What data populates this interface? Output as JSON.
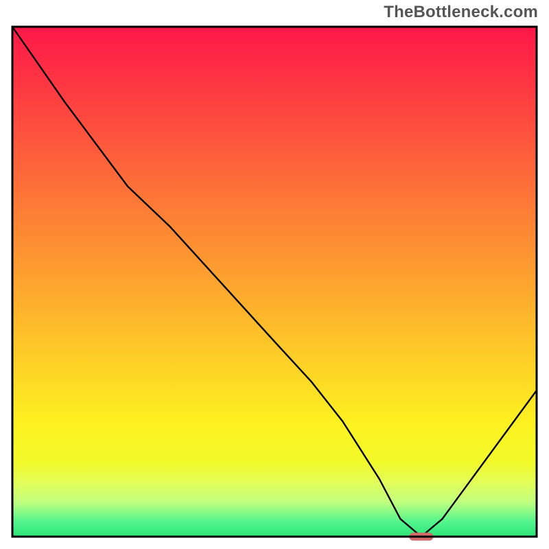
{
  "watermark": "TheBottleneck.com",
  "chart_data": {
    "type": "line",
    "title": "",
    "xlabel": "",
    "ylabel": "",
    "xlim": [
      0,
      100
    ],
    "ylim": [
      0,
      115
    ],
    "series": [
      {
        "name": "bottleneck-curve",
        "x": [
          0,
          10,
          22,
          30,
          40,
          50,
          57,
          63,
          70,
          74,
          78,
          82,
          100
        ],
        "y": [
          115,
          98,
          79,
          70,
          57,
          44,
          35,
          26,
          13,
          4,
          0,
          4,
          33
        ]
      }
    ],
    "marker": {
      "x": 78,
      "y": 0,
      "width_units": 4.6,
      "height_units": 1.8,
      "color": "#d46a6a"
    },
    "frame": {
      "x0": 18,
      "y0": 39,
      "x1": 782,
      "y1": 782,
      "stroke": "#000000",
      "stroke_width": 3
    },
    "gradient_stops": [
      {
        "offset": 0.0,
        "color": "#fd1848"
      },
      {
        "offset": 0.078,
        "color": "#fd2d44"
      },
      {
        "offset": 0.155,
        "color": "#fd4340"
      },
      {
        "offset": 0.233,
        "color": "#fd593c"
      },
      {
        "offset": 0.311,
        "color": "#fd6f38"
      },
      {
        "offset": 0.388,
        "color": "#fd8534"
      },
      {
        "offset": 0.466,
        "color": "#fd9a30"
      },
      {
        "offset": 0.544,
        "color": "#fdb02c"
      },
      {
        "offset": 0.621,
        "color": "#fdc628"
      },
      {
        "offset": 0.699,
        "color": "#fddc24"
      },
      {
        "offset": 0.777,
        "color": "#fdf120"
      },
      {
        "offset": 0.854,
        "color": "#f2fa29"
      },
      {
        "offset": 0.893,
        "color": "#e3fe58"
      },
      {
        "offset": 0.932,
        "color": "#c2ff7f"
      },
      {
        "offset": 0.971,
        "color": "#52f58d"
      },
      {
        "offset": 1.0,
        "color": "#2de578"
      }
    ]
  }
}
